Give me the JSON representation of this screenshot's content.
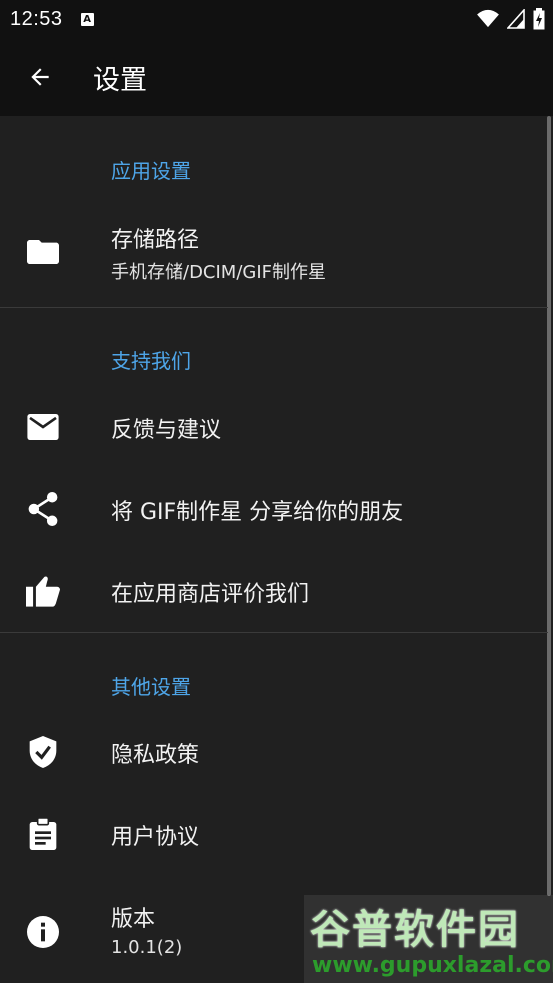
{
  "status": {
    "time": "12:53",
    "badge": "A"
  },
  "appbar": {
    "title": "设置"
  },
  "sections": {
    "app": {
      "title": "应用设置"
    },
    "support": {
      "title": "支持我们"
    },
    "other": {
      "title": "其他设置"
    }
  },
  "items": {
    "storage": {
      "label": "存储路径",
      "value": "手机存储/DCIM/GIF制作星",
      "icon": "folder-icon"
    },
    "feedback": {
      "label": "反馈与建议",
      "icon": "mail-icon"
    },
    "share": {
      "label": "将 GIF制作星 分享给你的朋友",
      "icon": "share-icon"
    },
    "rate": {
      "label": "在应用商店评价我们",
      "icon": "thumb-up-icon"
    },
    "privacy": {
      "label": "隐私政策",
      "icon": "shield-check-icon"
    },
    "agreement": {
      "label": "用户协议",
      "icon": "clipboard-icon"
    },
    "version": {
      "label": "版本",
      "value": "1.0.1(2)",
      "icon": "info-icon"
    }
  },
  "watermark": {
    "name": "谷普软件园",
    "url": "www.gupuxlazal.com"
  },
  "colors": {
    "accent": "#4ea5e8",
    "background": "#202020",
    "bar": "#111111"
  }
}
